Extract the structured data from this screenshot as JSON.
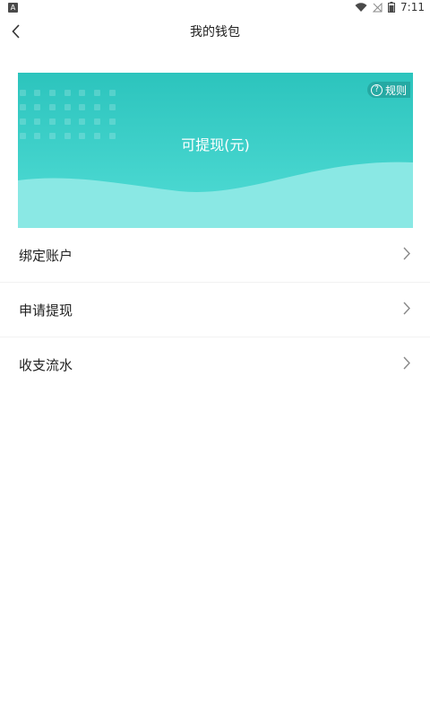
{
  "status_bar": {
    "left_badge": "A",
    "time": "7:11"
  },
  "nav": {
    "title": "我的钱包"
  },
  "card": {
    "rules_label": "规则",
    "help_glyph": "?",
    "balance_label": "可提现(元)",
    "colors": {
      "top": "#2cc4bd",
      "bottom": "#52ddd6",
      "wave": "#8ae8e4"
    }
  },
  "menu": {
    "items": [
      {
        "label": "绑定账户"
      },
      {
        "label": "申请提现"
      },
      {
        "label": "收支流水"
      }
    ]
  }
}
